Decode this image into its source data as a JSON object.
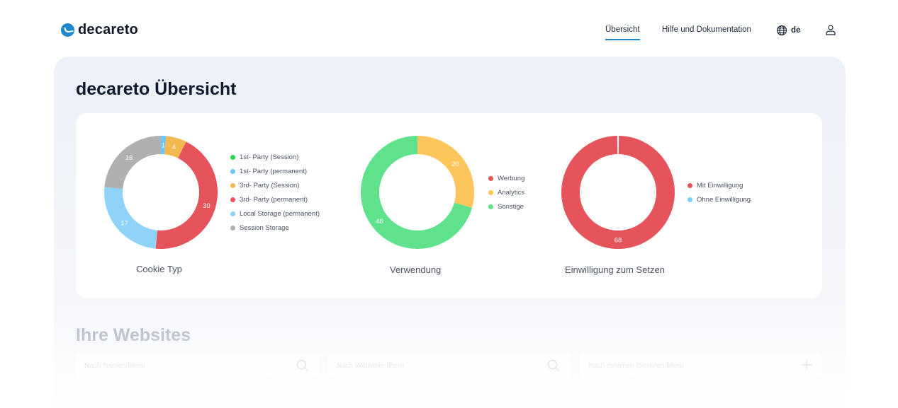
{
  "header": {
    "logo_text": "decareto",
    "nav": [
      {
        "label": "Übersicht",
        "active": true
      },
      {
        "label": "Hilfe und Dokumentation",
        "active": false
      }
    ],
    "language": "de",
    "icons": {
      "language": "globe-icon",
      "user": "user-icon"
    }
  },
  "main": {
    "title": "decareto Übersicht",
    "sites_title": "Ihre Websites",
    "filters": [
      {
        "placeholder": "Nach Namen filtern",
        "icon": "search-icon"
      },
      {
        "placeholder": "Nach Webseite filtern",
        "icon": "search-icon"
      },
      {
        "placeholder": "Nach externen Diensten filtern",
        "icon": "plus-icon"
      }
    ]
  },
  "colors": {
    "accent": "#1e88c9",
    "green": "#4fe28a",
    "blue": "#7cd1f7",
    "yellow": "#fdc65c",
    "red": "#e5545b",
    "gray": "#b0b0b0"
  },
  "chart_data": [
    {
      "type": "pie",
      "title": "Cookie Typ",
      "categories": [
        "1st- Party (Session)",
        "1st- Party (permanent)",
        "3rd- Party (Session)",
        "3rd- Party (permanent)",
        "Local Storage (permanent)",
        "Session Storage"
      ],
      "values": [
        0,
        1,
        4,
        30,
        17,
        16
      ],
      "colors": [
        "#27d84a",
        "#6cc6f5",
        "#f5b74f",
        "#e5545b",
        "#8fd3f8",
        "#b0b0b0"
      ]
    },
    {
      "type": "pie",
      "title": "Verwendung",
      "categories": [
        "Werbung",
        "Analytics",
        "Sonstige"
      ],
      "values": [
        0,
        20,
        48
      ],
      "colors": [
        "#e5545b",
        "#fdc65c",
        "#5ee28c"
      ]
    },
    {
      "type": "pie",
      "title": "Einwilligung zum Setzen",
      "categories": [
        "Mit Einwilligung",
        "Ohne Einwilligung"
      ],
      "values": [
        68,
        0
      ],
      "colors": [
        "#e5545b",
        "#7cd1f7"
      ]
    }
  ]
}
